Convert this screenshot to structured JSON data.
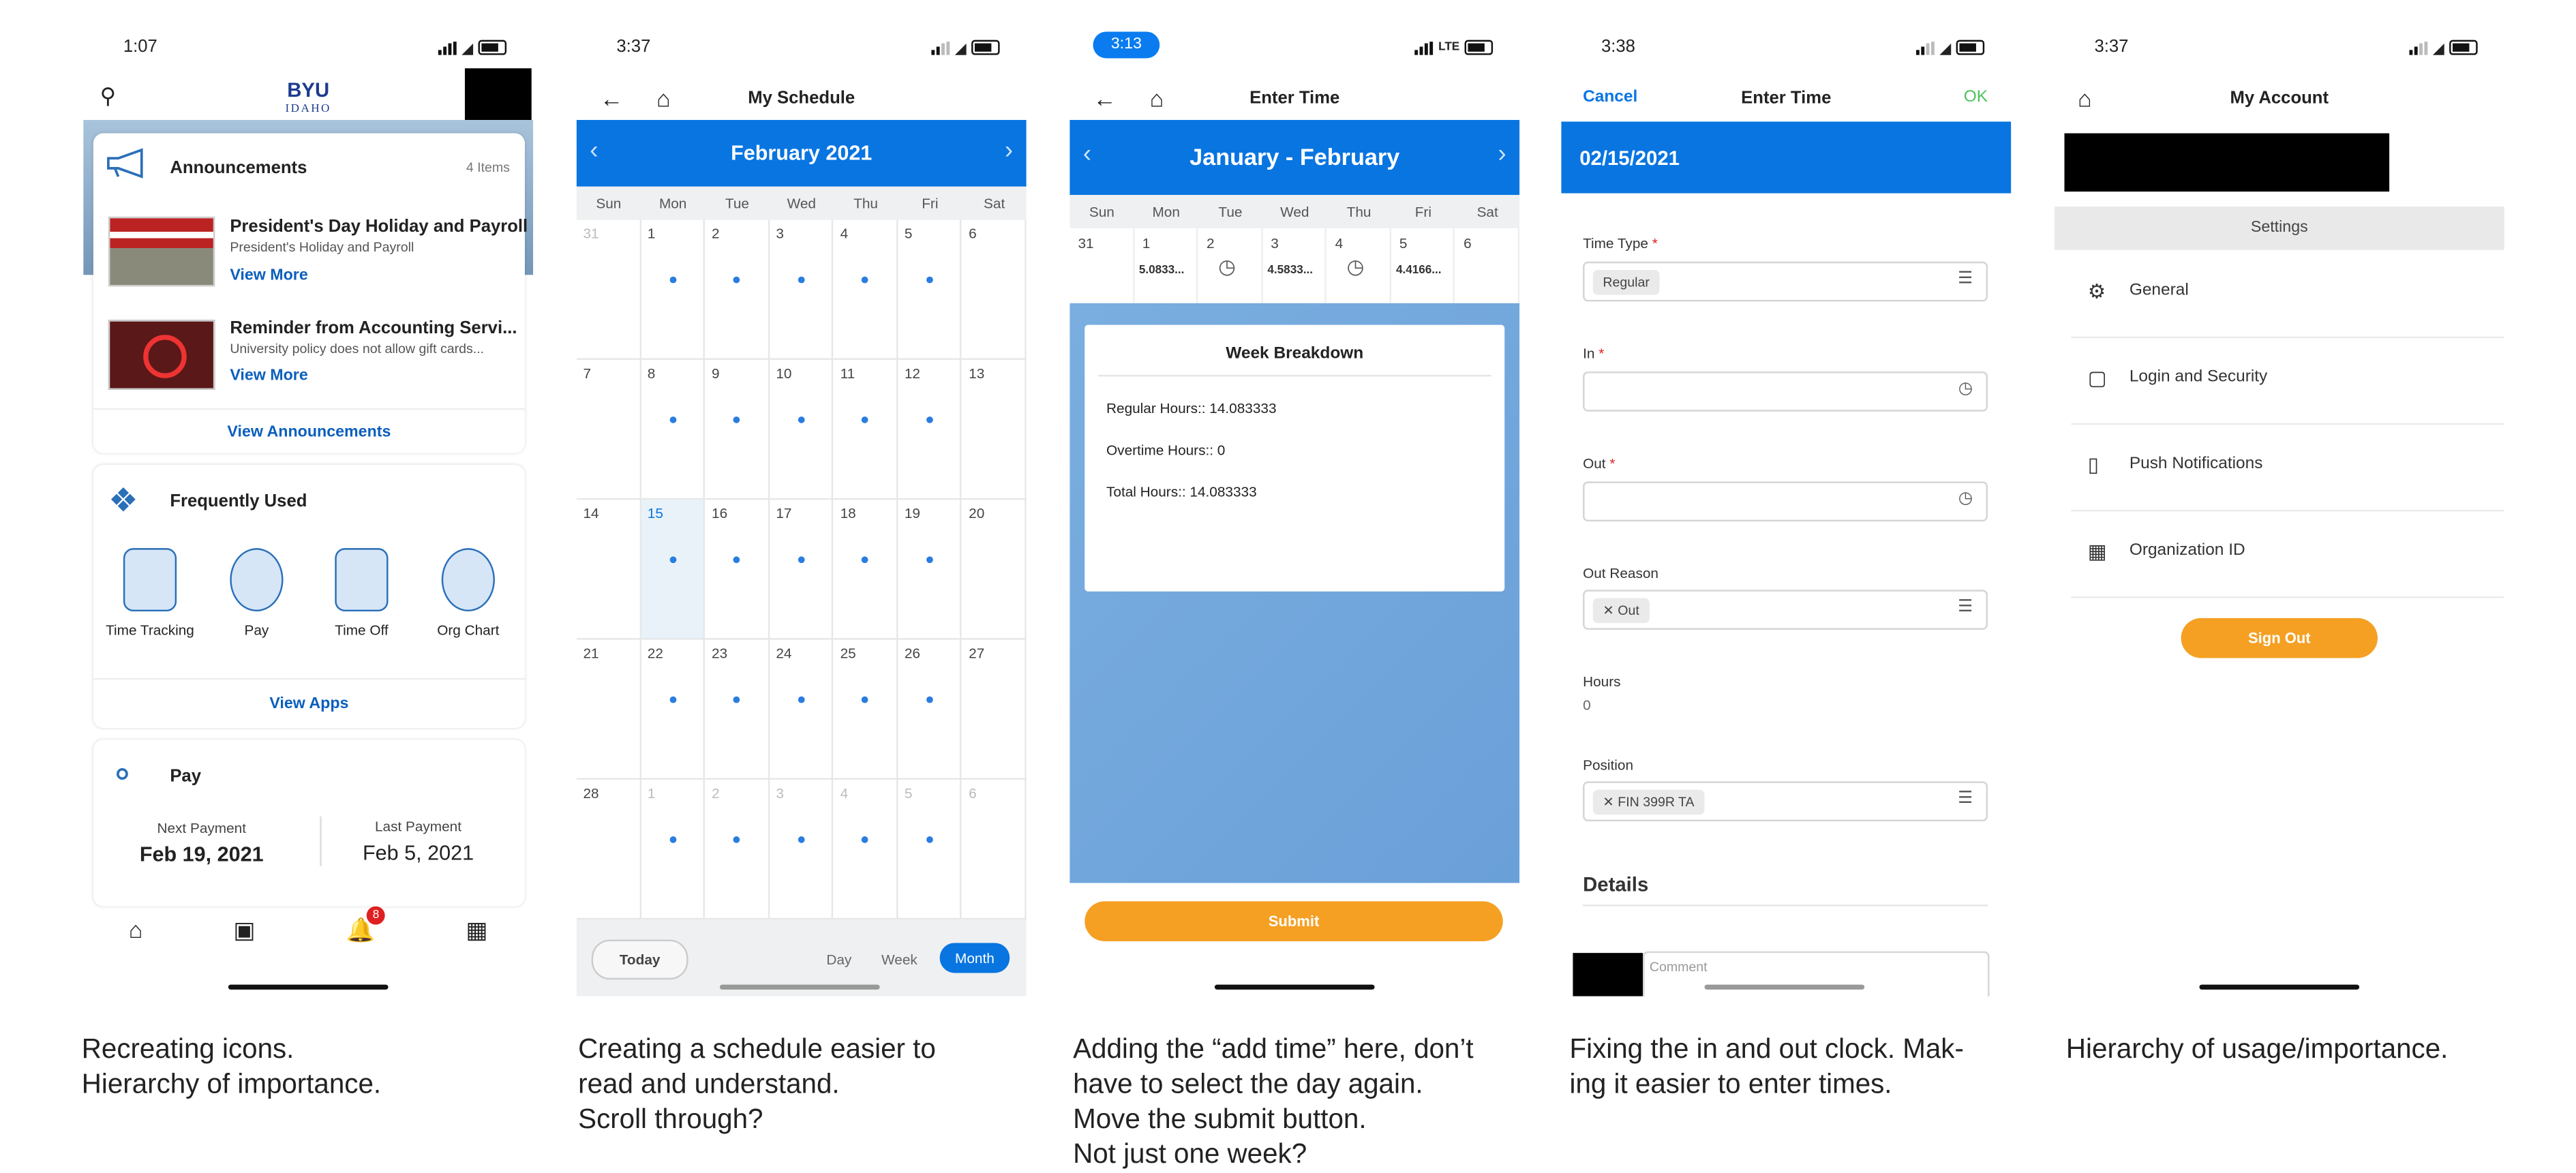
{
  "screens": {
    "home": {
      "time": "1:07",
      "logo_line1": "BYU",
      "logo_line2": "IDAHO",
      "announcements": {
        "title": "Announcements",
        "count": "4 Items",
        "items": [
          {
            "title": "President's Day Holiday and Payroll",
            "subtitle": "President's Holiday and Payroll",
            "link": "View More"
          },
          {
            "title": "Reminder from Accounting Servi...",
            "subtitle": "University policy does not allow gift cards...",
            "link": "View More"
          }
        ],
        "view_all": "View Announcements"
      },
      "frequently_used": {
        "title": "Frequently Used",
        "apps": [
          "Time Tracking",
          "Pay",
          "Time Off",
          "Org Chart"
        ],
        "view_apps": "View Apps"
      },
      "pay": {
        "title": "Pay",
        "next_label": "Next Payment",
        "next_value": "Feb 19, 2021",
        "last_label": "Last Payment",
        "last_value": "Feb 5, 2021"
      },
      "notification_count": "8"
    },
    "schedule": {
      "time": "3:37",
      "title": "My Schedule",
      "month": "February 2021",
      "days": [
        "Sun",
        "Mon",
        "Tue",
        "Wed",
        "Thu",
        "Fri",
        "Sat"
      ],
      "weeks": [
        [
          "31",
          "1",
          "2",
          "3",
          "4",
          "5",
          "6"
        ],
        [
          "7",
          "8",
          "9",
          "10",
          "11",
          "12",
          "13"
        ],
        [
          "14",
          "15",
          "16",
          "17",
          "18",
          "19",
          "20"
        ],
        [
          "21",
          "22",
          "23",
          "24",
          "25",
          "26",
          "27"
        ],
        [
          "28",
          "1",
          "2",
          "3",
          "4",
          "5",
          "6"
        ]
      ],
      "today_button": "Today",
      "views": [
        "Day",
        "Week",
        "Month"
      ]
    },
    "enter_time": {
      "time": "3:13",
      "network": "LTE",
      "title": "Enter Time",
      "range": "January - February",
      "days": [
        "Sun",
        "Mon",
        "Tue",
        "Wed",
        "Thu",
        "Fri",
        "Sat"
      ],
      "dates": [
        "31",
        "1",
        "2",
        "3",
        "4",
        "5",
        "6"
      ],
      "hours": [
        "",
        "5.0833...",
        "",
        "4.5833...",
        "",
        "4.4166...",
        ""
      ],
      "breakdown": {
        "title": "Week Breakdown",
        "regular": "Regular Hours:: 14.083333",
        "overtime": "Overtime Hours:: 0",
        "total": "Total Hours:: 14.083333"
      },
      "submit": "Submit"
    },
    "enter_time_form": {
      "time": "3:38",
      "cancel": "Cancel",
      "title": "Enter Time",
      "ok": "OK",
      "date": "02/15/2021",
      "time_type_label": "Time Type",
      "time_type_value": "Regular",
      "in_label": "In",
      "out_label": "Out",
      "out_reason_label": "Out Reason",
      "out_reason_value": "Out",
      "hours_label": "Hours",
      "hours_value": "0",
      "position_label": "Position",
      "position_value": "FIN 399R TA",
      "details": "Details",
      "comment_placeholder": "Comment"
    },
    "account": {
      "time": "3:37",
      "title": "My Account",
      "settings": "Settings",
      "items": [
        "General",
        "Login and Security",
        "Push Notifications",
        "Organization ID"
      ],
      "sign_out": "Sign Out"
    }
  },
  "captions": {
    "c1": [
      "Recreating icons.",
      "Hierarchy of importance."
    ],
    "c2": [
      "Creating a schedule easier to",
      "read and understand.",
      "Scroll through?"
    ],
    "c3": [
      "Adding the “add time” here, don’t",
      "have to select the day again.",
      "Move the submit button.",
      "Not just one week?"
    ],
    "c4": [
      "Fixing the in and out clock. Mak-",
      "ing it easier to enter times."
    ],
    "c5": [
      "Hierarchy of usage/importance."
    ]
  },
  "colors": {
    "accent": "#0875e1",
    "orange": "#f5a023",
    "ok_green": "#4cc35a"
  }
}
